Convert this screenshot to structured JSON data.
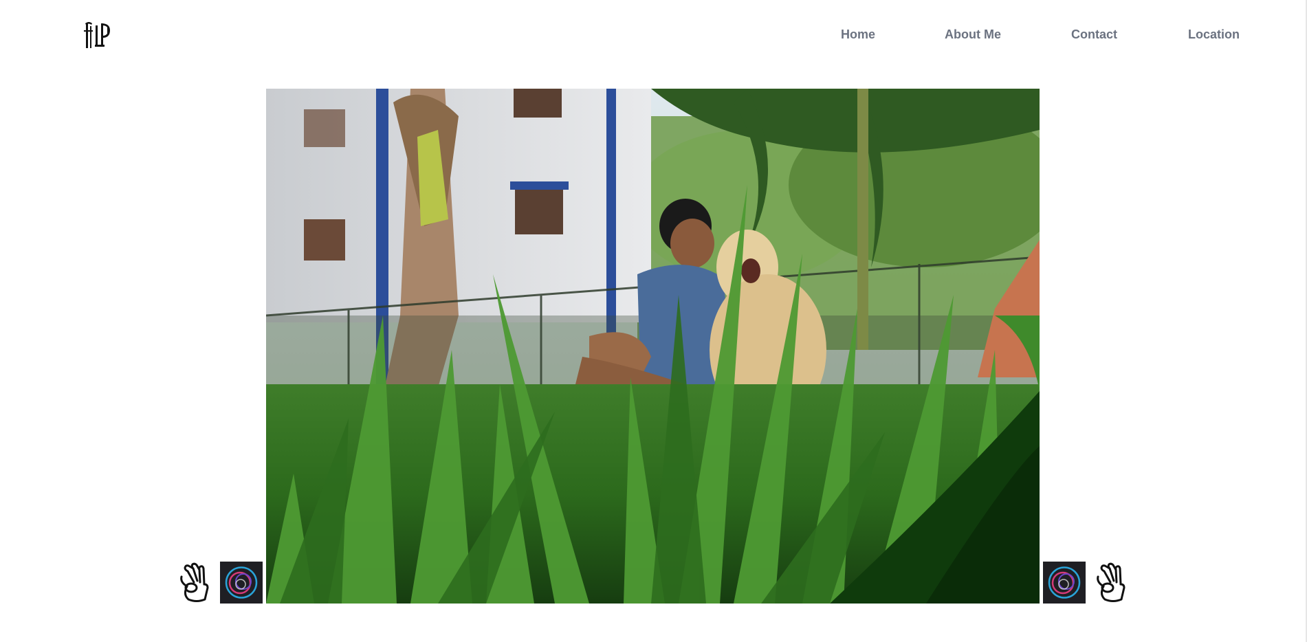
{
  "header": {
    "logo_icon": "fill-logo-icon",
    "nav": [
      {
        "label": "Home"
      },
      {
        "label": "About Me"
      },
      {
        "label": "Contact"
      },
      {
        "label": "Location"
      }
    ]
  },
  "hero": {
    "image": "photo of a man with a labrador dog in a garden behind tall grass"
  },
  "decorations": {
    "left": [
      "ok-hand-icon",
      "swirl-orb-icon"
    ],
    "right": [
      "swirl-orb-icon",
      "ok-hand-icon"
    ]
  },
  "colors": {
    "nav_text": "#6b7280",
    "background": "#ffffff",
    "orb_tile": "#1f1f24"
  }
}
